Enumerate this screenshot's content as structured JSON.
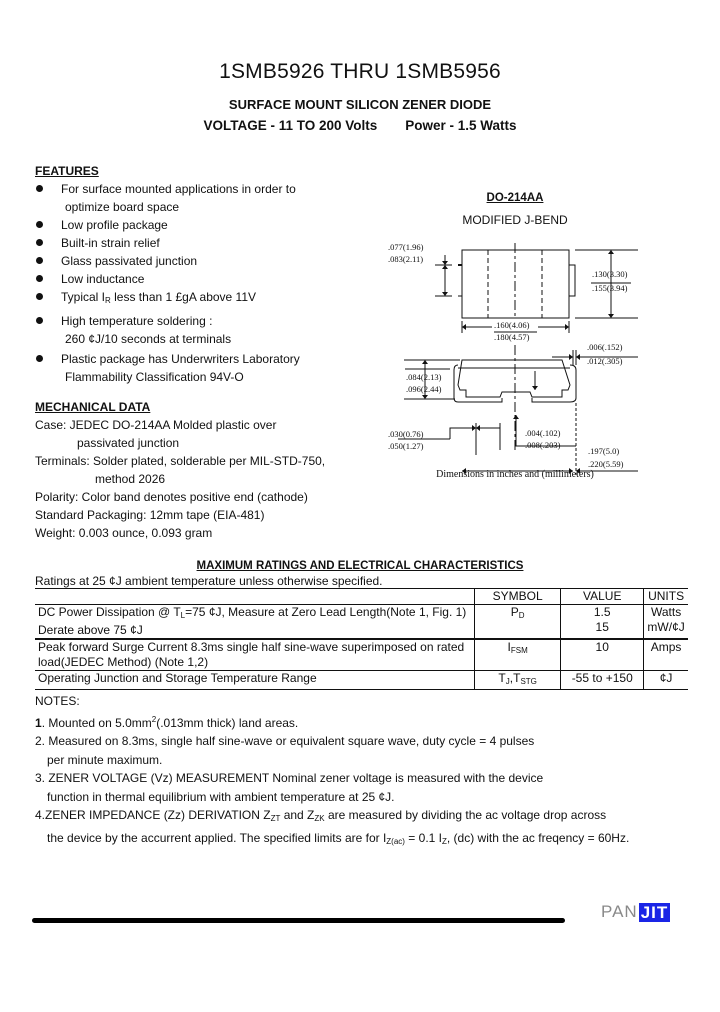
{
  "header": {
    "title": "1SMB5926 THRU 1SMB5956",
    "subtitle": "SURFACE MOUNT SILICON ZENER DIODE",
    "voltage": "VOLTAGE - 11 TO 200 Volts",
    "power": "Power - 1.5 Watts"
  },
  "features": {
    "heading": "FEATURES",
    "items": [
      {
        "label": "For surface mounted applications in order to",
        "cont": "optimize board space"
      },
      {
        "label": "Low profile package",
        "cont": ""
      },
      {
        "label": "Built-in strain relief",
        "cont": ""
      },
      {
        "label": "Glass passivated junction",
        "cont": ""
      },
      {
        "label": "Low inductance",
        "cont": ""
      },
      {
        "label_pre": "Typical I",
        "label_sub": "R",
        "label_post": " less than 1 £gA above 11V",
        "cont": ""
      },
      {
        "label": "High temperature soldering :",
        "cont": "260 ¢J/10 seconds at terminals"
      },
      {
        "label": "Plastic package has Underwriters Laboratory",
        "cont": "Flammability Classification 94V-O"
      }
    ]
  },
  "mechanical": {
    "heading": "MECHANICAL DATA",
    "case": "Case: JEDEC DO-214AA Molded plastic over",
    "case_cont": "passivated junction",
    "terminals": "Terminals: Solder plated, solderable per MIL-STD-750,",
    "terminals_cont": "method 2026",
    "polarity": "Polarity: Color band denotes positive end (cathode)",
    "packaging": "Standard Packaging: 12mm tape (EIA-481)",
    "weight": "Weight: 0.003 ounce, 0.093 gram"
  },
  "diagram": {
    "package": "DO-214AA",
    "style": "MODIFIED J-BEND",
    "caption": "Dimensions in inches and (millimeters)",
    "dims": {
      "lead_h_min": ".077(1.96)",
      "lead_h_max": ".083(2.11)",
      "body_w_min": ".130(3.30)",
      "body_w_max": ".155(3.94)",
      "body_l_min": ".160(4.06)",
      "body_l_max": ".180(4.57)",
      "lead_t_min": ".006(.152)",
      "lead_t_max": ".012(.305)",
      "height_min": ".084(2.13)",
      "height_max": ".096(2.44)",
      "foot_min": ".030(0.76)",
      "foot_max": ".050(1.27)",
      "standoff_min": ".004(.102)",
      "standoff_max": ".008(.203)",
      "overall_min": ".197(5.0)",
      "overall_max": ".220(5.59)"
    }
  },
  "ratings": {
    "heading": "MAXIMUM RATINGS AND ELECTRICAL CHARACTERISTICS",
    "note": "Ratings at 25 ¢J ambient temperature unless otherwise specified.",
    "columns": {
      "symbol": "SYMBOL",
      "value": "VALUE",
      "units": "UNITS"
    },
    "rows": [
      {
        "desc_pre": "DC Power Dissipation @ T",
        "desc_sub": "L",
        "desc_post": "=75 ¢J, Measure at Zero Lead Length(Note 1, Fig. 1)",
        "desc2": "Derate above 75 ¢J",
        "symbol": "P",
        "symbol_sub": "D",
        "value": "1.5",
        "value2": "15",
        "units": "Watts",
        "units2": "mW/¢J"
      },
      {
        "desc": "Peak forward Surge Current 8.3ms single half sine-wave superimposed on rated",
        "desc2": "load(JEDEC Method) (Note 1,2)",
        "symbol": "I",
        "symbol_sub": "FSM",
        "value": "10",
        "units": "Amps"
      },
      {
        "desc": "Operating Junction and Storage Temperature Range",
        "symbol": "T",
        "symbol_sub": "J",
        "symbol2": ",T",
        "symbol2_sub": "STG",
        "value": "-55 to +150",
        "units": "¢J"
      }
    ]
  },
  "notes": {
    "heading": "NOTES:",
    "n1_num": "1",
    "n1_pre": ". Mounted on 5.0mm",
    "n1_sup": "2",
    "n1_post": "(.013mm thick) land areas.",
    "n2": "2. Measured on 8.3ms, single half sine-wave or equivalent square wave, duty cycle = 4 pulses",
    "n2_cont": "per minute maximum.",
    "n3": "3. ZENER VOLTAGE (Vz) MEASUREMENT Nominal zener voltage is measured with the device",
    "n3_cont": "function in thermal equilibrium with ambient temperature at 25 ¢J.",
    "n4_pre": "4.ZENER IMPEDANCE (Zz) DERIVATION Z",
    "n4_sub1": "ZT",
    "n4_mid": " and Z",
    "n4_sub2": "ZK",
    "n4_post": " are measured by dividing the ac voltage drop across",
    "n4_cont_pre": "the device by the accurrent applied. The specified limits are for I",
    "n4_cont_sub1": "Z(ac)",
    "n4_cont_mid": " = 0.1 I",
    "n4_cont_sub2": "Z",
    "n4_cont_post": ", (dc) with the ac freqency = 60Hz."
  },
  "footer": {
    "logo_pan": "PAN",
    "logo_jit": "JIT",
    "brand_color": "#1a25e6"
  }
}
